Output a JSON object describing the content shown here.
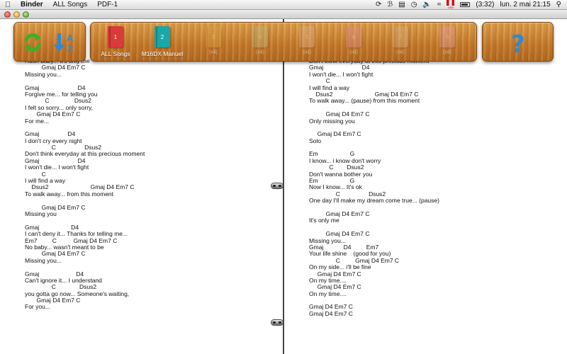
{
  "menubar": {
    "app_name": "Binder",
    "menus": [
      "ALL Songs",
      "PDF-1"
    ],
    "battery_text": "(3:32)",
    "flag_label": "USA",
    "datetime": "lun. 2 mai  21:15"
  },
  "toolbar": {
    "books": [
      {
        "number": "1",
        "label": "ALL Songs",
        "color": "#d93a3a",
        "active": true
      },
      {
        "number": "2",
        "label": "M16DX Manuel",
        "color": "#1aa7a8",
        "active": true
      },
      {
        "number": "3",
        "label": "(nil)",
        "color": "#d9a441",
        "active": false
      },
      {
        "number": "4",
        "label": "(nil)",
        "color": "#b7c28a",
        "active": false
      },
      {
        "number": "5",
        "label": "(nil)",
        "color": "#e3b99a",
        "active": false
      },
      {
        "number": "6",
        "label": "(nil)",
        "color": "#e48fa0",
        "active": false
      },
      {
        "number": "7",
        "label": "(nil)",
        "color": "#d9b88d",
        "active": false
      },
      {
        "number": "8",
        "label": "(nil)",
        "color": "#e7a3b3",
        "active": false
      }
    ]
  },
  "left_page": [
    "Hush baby... it's only me",
    "          Gmaj D4 Em7 C",
    "Missing you...",
    "",
    "Gmaj                       D4",
    "Forgive me... for telling you",
    "            C               Dsus2",
    "I felt so sorry... only sorry,",
    "       Gmaj D4 Em7 C",
    "For me...",
    "",
    "Gmaj                 D4",
    "I don't cry every night",
    "                C                 Dsus2",
    "Don't think everyday at this precious moment",
    "Gmaj                       D4",
    "I won't die... I won't fight",
    "          C",
    "I will find a way",
    "    Dsus2                         Gmaj D4 Em7 C",
    "To walk away... from this moment",
    "",
    "          Gmaj D4 Em7 C",
    "Missing you",
    "",
    "Gmaj                   D4",
    "I can't deny it... Thanks for telling me...",
    "Em7         C          Gmaj D4 Em7 C",
    "No baby... wasn't meant to be",
    "          Gmaj D4 Em7 C",
    "Missing you...",
    "",
    "Gmaj                      D4",
    "Can't ignore it... I understand",
    "                C              Dsus2",
    "you gotta go now... Someone's waiting,",
    "       Gmaj D4 Em7 C",
    "For you..."
  ],
  "right_page": [
    "Don't think everyday at this precious moment",
    "Gmaj                       D4",
    "I won't die... I won't fight",
    "          C",
    "I will find a way",
    "    Dsus2                         Gmaj D4 Em7 C",
    "To walk away... (pause) from this moment",
    "",
    "          Gmaj D4 Em7 C",
    "Only missing you",
    "",
    "     Gmaj D4 Em7 C",
    "Solo",
    "",
    "Em                   G",
    "I know... i know don't worry",
    "            C        Dsus2",
    "Don't wanna bother you",
    "Em                   G",
    "Now I know... It's ok",
    "                C                 Dsus2",
    "One day I'll make my dream come true... (pause)",
    "",
    "          Gmaj D4 Em7 C",
    "It's only me",
    "",
    "          Gmaj D4 Em7 C",
    "Missing you...",
    "Gmaj            D4         Em7",
    "Your life shine    (good for you)",
    "                C         Gmaj D4 Em7 C",
    "On my side... i'll be fine",
    "     Gmaj D4 Em7 C",
    "On my time....",
    "     Gmaj D4 Em7 C",
    "On my time....",
    "",
    "Gmaj D4 Em7 C",
    "Gmaj D4 Em7 C"
  ]
}
